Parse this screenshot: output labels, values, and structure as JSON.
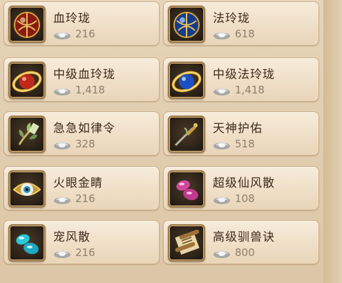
{
  "shop": {
    "items": [
      {
        "name": "血玲珑",
        "price": "216",
        "icon": "red-orb-icon"
      },
      {
        "name": "法玲珑",
        "price": "618",
        "icon": "blue-orb-icon"
      },
      {
        "name": "中级血玲珑",
        "price": "1,418",
        "icon": "red-ring-orb-icon"
      },
      {
        "name": "中级法玲珑",
        "price": "1,418",
        "icon": "blue-ring-orb-icon"
      },
      {
        "name": "急急如律令",
        "price": "328",
        "icon": "talisman-leaf-icon"
      },
      {
        "name": "天神护佑",
        "price": "518",
        "icon": "divine-dagger-icon"
      },
      {
        "name": "火眼金睛",
        "price": "216",
        "icon": "golden-eye-icon"
      },
      {
        "name": "超级仙风散",
        "price": "108",
        "icon": "pink-gems-icon"
      },
      {
        "name": "宠风散",
        "price": "216",
        "icon": "cyan-gems-icon"
      },
      {
        "name": "高级驯兽诀",
        "price": "800",
        "icon": "scroll-icon"
      }
    ],
    "currency_icon": "silver-ingot-icon"
  }
}
